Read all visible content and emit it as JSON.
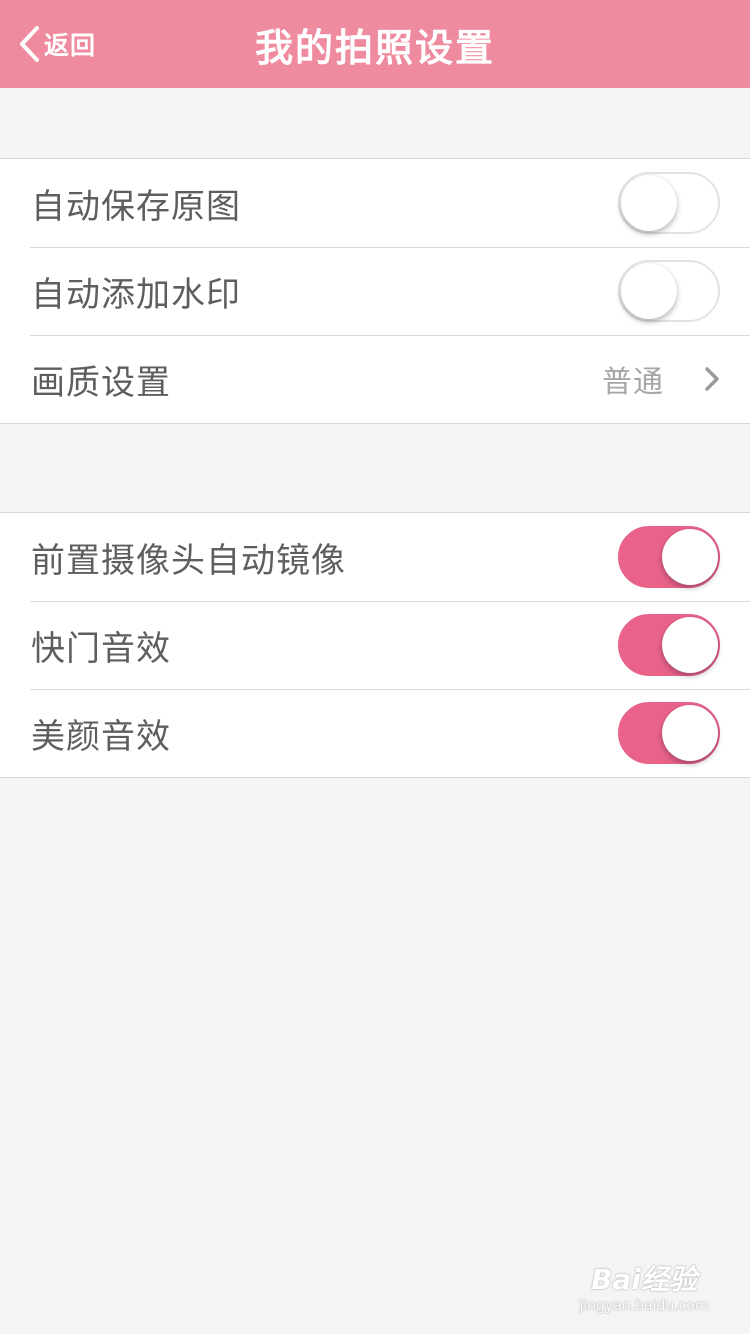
{
  "navbar": {
    "back_label": "返回",
    "title": "我的拍照设置",
    "background": "#ef8b9e"
  },
  "group1": {
    "rows": [
      {
        "label": "自动保存原图",
        "type": "toggle",
        "on": false
      },
      {
        "label": "自动添加水印",
        "type": "toggle",
        "on": false
      },
      {
        "label": "画质设置",
        "type": "disclosure",
        "value": "普通"
      }
    ]
  },
  "group2": {
    "rows": [
      {
        "label": "前置摄像头自动镜像",
        "type": "toggle",
        "on": true
      },
      {
        "label": "快门音效",
        "type": "toggle",
        "on": true
      },
      {
        "label": "美颜音效",
        "type": "toggle",
        "on": true
      }
    ]
  },
  "colors": {
    "accent": "#e8628a",
    "page_bg": "#f4f4f4"
  },
  "watermark": {
    "brand": "Bai经验",
    "url": "jingyan.baidu.com"
  }
}
